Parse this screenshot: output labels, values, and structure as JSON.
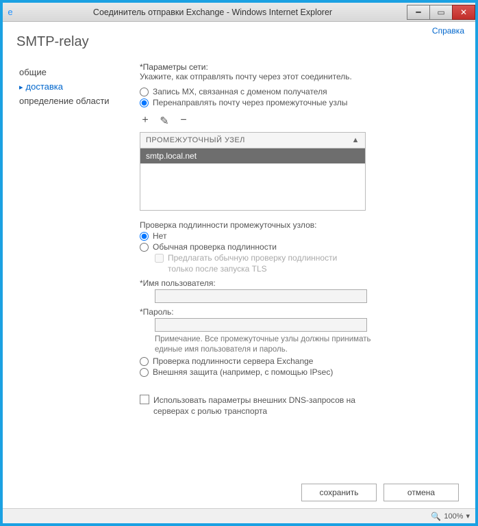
{
  "window": {
    "title": "Соединитель отправки Exchange - Windows Internet Explorer"
  },
  "help": "Справка",
  "page_title": "SMTP-relay",
  "sidebar": {
    "items": [
      {
        "label": "общие"
      },
      {
        "label": "доставка"
      },
      {
        "label": "определение области"
      }
    ]
  },
  "main": {
    "net_params_label": "*Параметры сети:",
    "net_params_hint": "Укажите, как отправлять почту через этот соединитель.",
    "routing": {
      "mx": "Запись MX, связанная с доменом получателя",
      "smarthost": "Перенаправлять почту через промежуточные узлы"
    },
    "list": {
      "header": "ПРОМЕЖУТОЧНЫЙ УЗЕЛ",
      "rows": [
        "smtp.local.net"
      ]
    },
    "auth_header": "Проверка подлинности промежуточных узлов:",
    "auth": {
      "none": "Нет",
      "basic": "Обычная проверка подлинности",
      "basic_tls": "Предлагать обычную проверку подлинности только после запуска TLS",
      "user_label": "*Имя пользователя:",
      "pass_label": "*Пароль:",
      "note": "Примечание. Все промежуточные узлы должны принимать единые имя пользователя и пароль.",
      "exchange": "Проверка подлинности сервера Exchange",
      "external": "Внешняя защита (например, с помощью IPsec)"
    },
    "dns_checkbox": "Использовать параметры внешних DNS-запросов на серверах с ролью транспорта"
  },
  "footer": {
    "save": "сохранить",
    "cancel": "отмена"
  },
  "status": {
    "zoom": "100%"
  }
}
